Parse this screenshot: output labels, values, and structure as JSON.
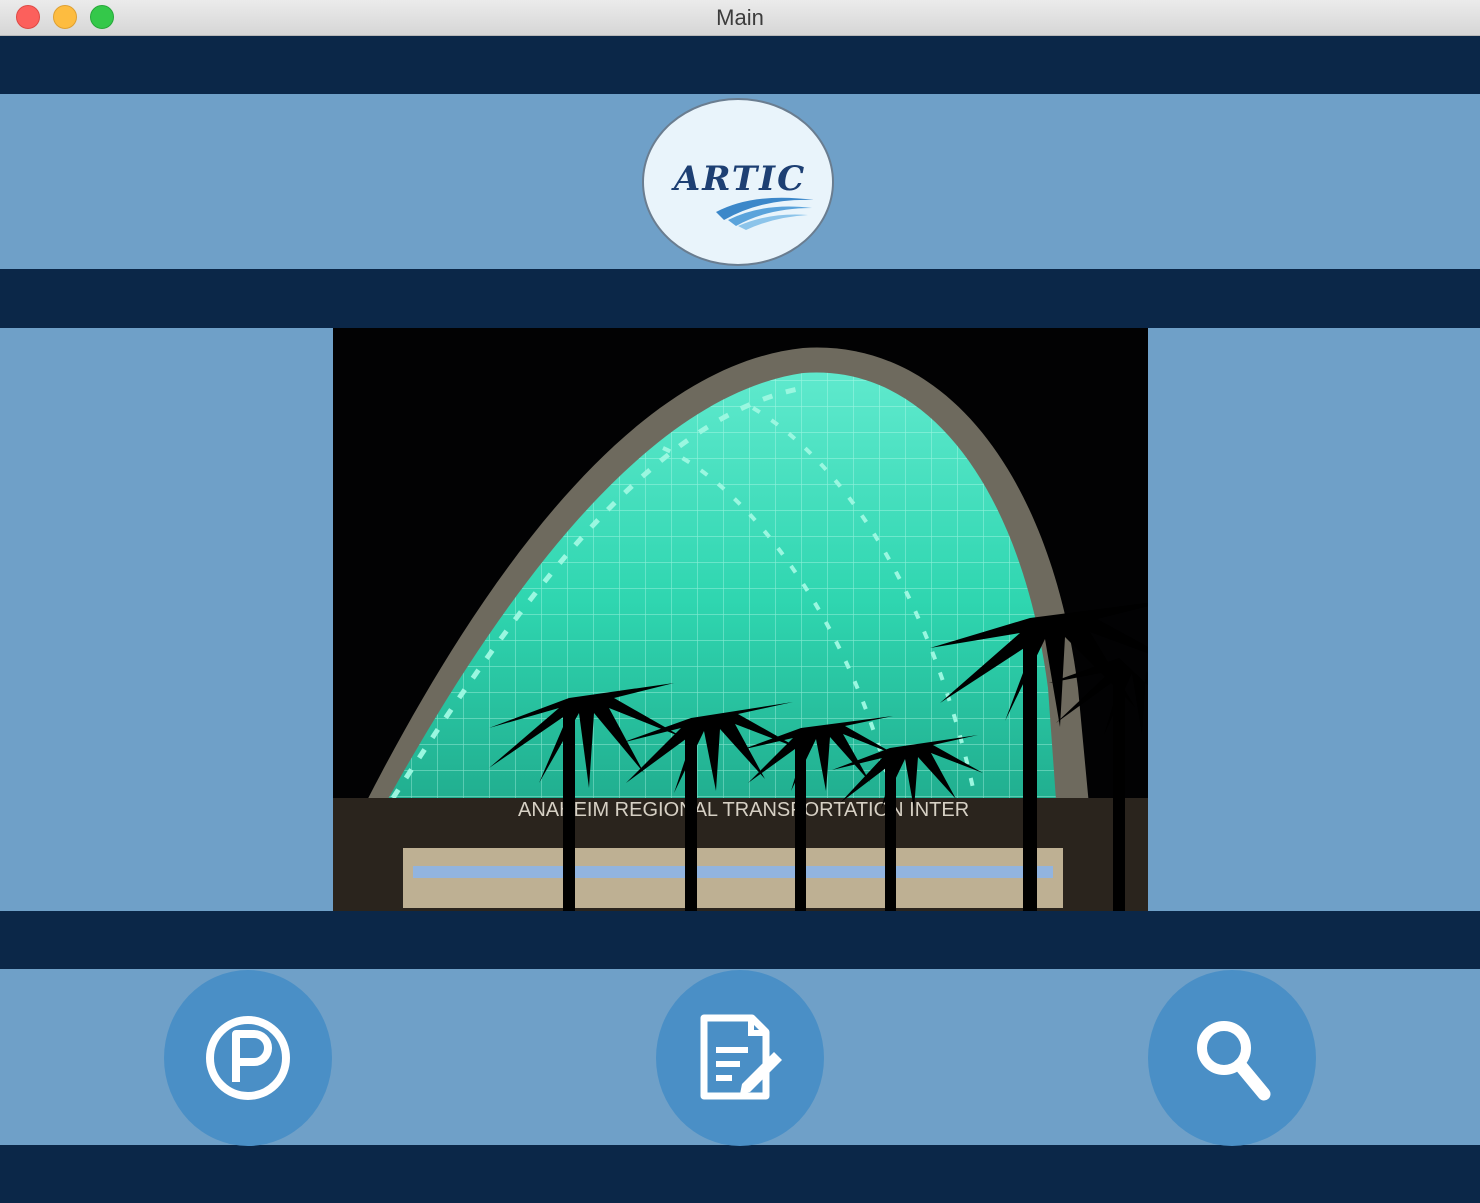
{
  "window": {
    "title": "Main"
  },
  "header": {
    "logo_text": "ARTIC",
    "logo_color": "#1d3f73"
  },
  "hero": {
    "sign_text": "ANAHEIM REGIONAL TRANSPORTATION INTER"
  },
  "actions": [
    {
      "icon": "parking-icon"
    },
    {
      "icon": "document-edit-icon"
    },
    {
      "icon": "search-icon"
    }
  ],
  "colors": {
    "nav_band": "#0b2748",
    "background": "#6fa0c8",
    "button": "#4a8fc6",
    "arch_glow": "#3ff0c4"
  }
}
